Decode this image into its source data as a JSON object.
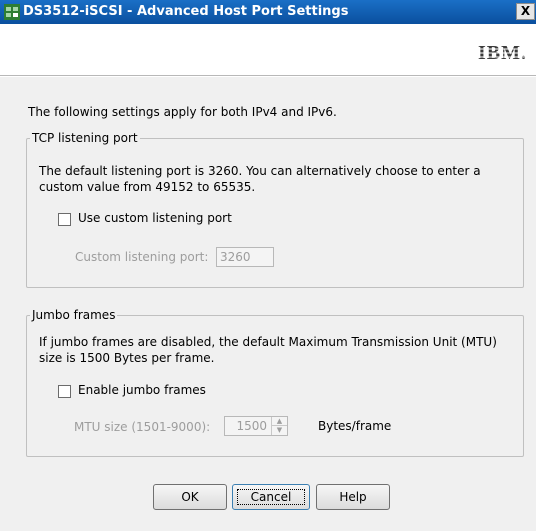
{
  "window": {
    "title": "DS3512-iSCSI - Advanced Host Port Settings",
    "close_label": "X",
    "logo_text": "IBM."
  },
  "intro_text": "The following settings apply for both IPv4 and IPv6.",
  "tcp": {
    "legend": "TCP listening port",
    "description": "The default listening port is 3260. You can alternatively choose to enter a custom value from 49152 to 65535.",
    "checkbox_label": "Use custom listening port",
    "checkbox_checked": false,
    "port_label": "Custom listening port:",
    "port_value": "3260"
  },
  "jumbo": {
    "legend": "Jumbo frames",
    "description": "If jumbo frames are disabled, the default Maximum Transmission Unit (MTU) size is 1500 Bytes per frame.",
    "checkbox_label": "Enable jumbo frames",
    "checkbox_checked": false,
    "mtu_label": "MTU size (1501-9000):",
    "mtu_value": "1500",
    "unit_label": "Bytes/frame"
  },
  "buttons": {
    "ok": "OK",
    "cancel": "Cancel",
    "help": "Help"
  },
  "icons": {
    "app": "storage-manager-icon",
    "close": "close-icon",
    "spin_up": "spin-up-icon",
    "spin_down": "spin-down-icon"
  }
}
